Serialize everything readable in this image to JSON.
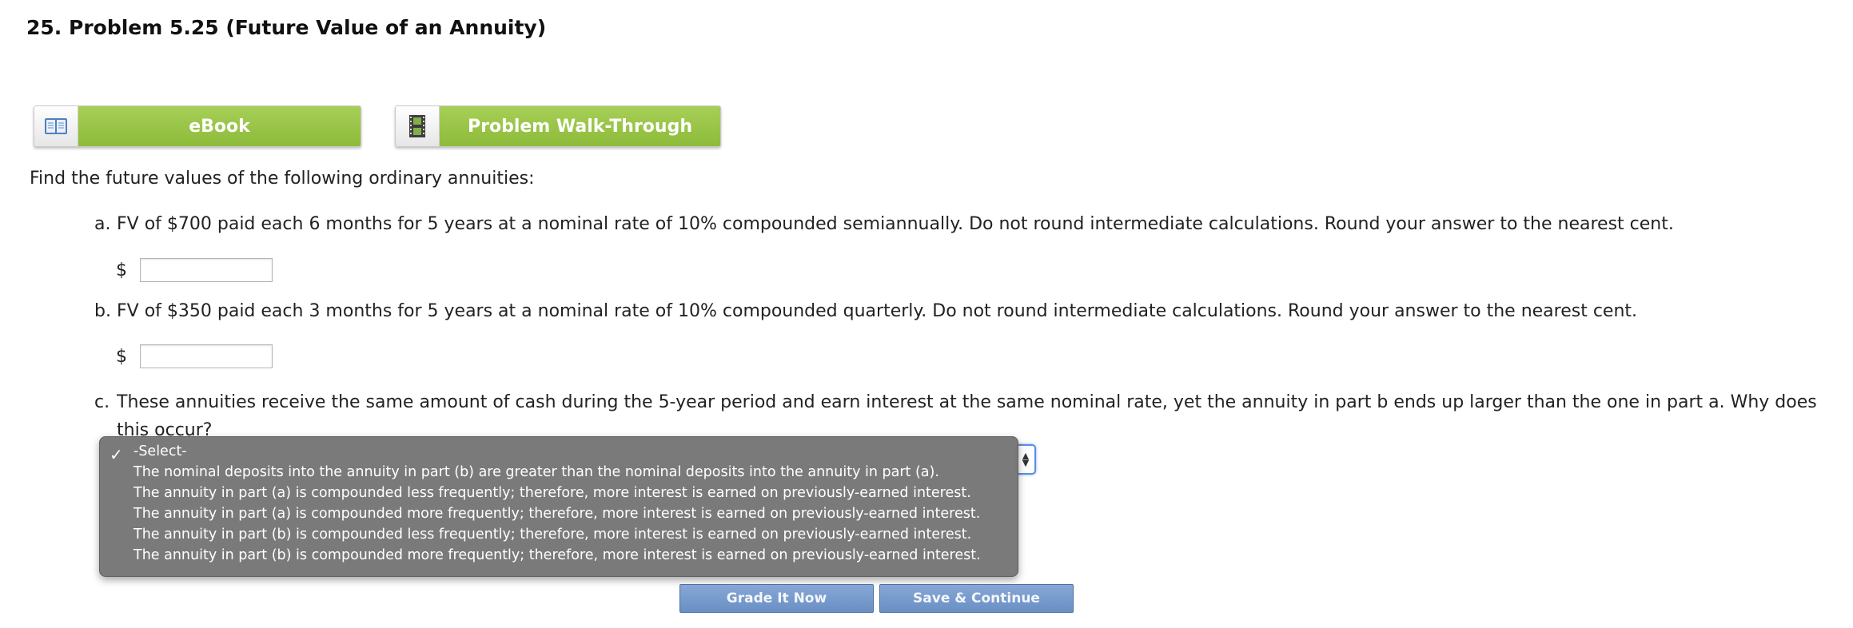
{
  "problem": {
    "title": "25.  Problem 5.25 (Future Value of an Annuity)"
  },
  "resources": {
    "ebook_label": "eBook",
    "walkthrough_label": "Problem Walk-Through"
  },
  "question": {
    "intro": "Find the future values of the following ordinary annuities:",
    "parts": [
      {
        "letter": "a.",
        "text": "FV of $700 paid each 6 months for 5 years at a nominal rate of 10% compounded semiannually. Do not round intermediate calculations. Round your answer to the nearest cent.",
        "currency": "$",
        "value": ""
      },
      {
        "letter": "b.",
        "text": "FV of $350 paid each 3 months for 5 years at a nominal rate of 10% compounded quarterly. Do not round intermediate calculations. Round your answer to the nearest cent.",
        "currency": "$",
        "value": ""
      },
      {
        "letter": "c.",
        "text": "These annuities receive the same amount of cash during the 5-year period and earn interest at the same nominal rate, yet the annuity in part b ends up larger than the one in part a. Why does this occur?"
      }
    ]
  },
  "dropdown": {
    "selected": "-Select-",
    "options": [
      "-Select-",
      "The nominal deposits into the annuity in part (b) are greater than the nominal deposits into the annuity in part (a).",
      "The annuity in part (a) is compounded less frequently; therefore, more interest is earned on previously-earned interest.",
      "The annuity in part (a) is compounded more frequently; therefore, more interest is earned on previously-earned interest.",
      "The annuity in part (b) is compounded less frequently; therefore, more interest is earned on previously-earned interest.",
      "The annuity in part (b) is compounded more frequently; therefore, more interest is earned on previously-earned interest."
    ]
  },
  "actions": {
    "grade_label": "Grade It Now",
    "save_label": "Save & Continue"
  },
  "colors": {
    "resource_green": "#9bc84b",
    "action_blue": "#7799cc",
    "dropdown_gray": "#767676"
  }
}
